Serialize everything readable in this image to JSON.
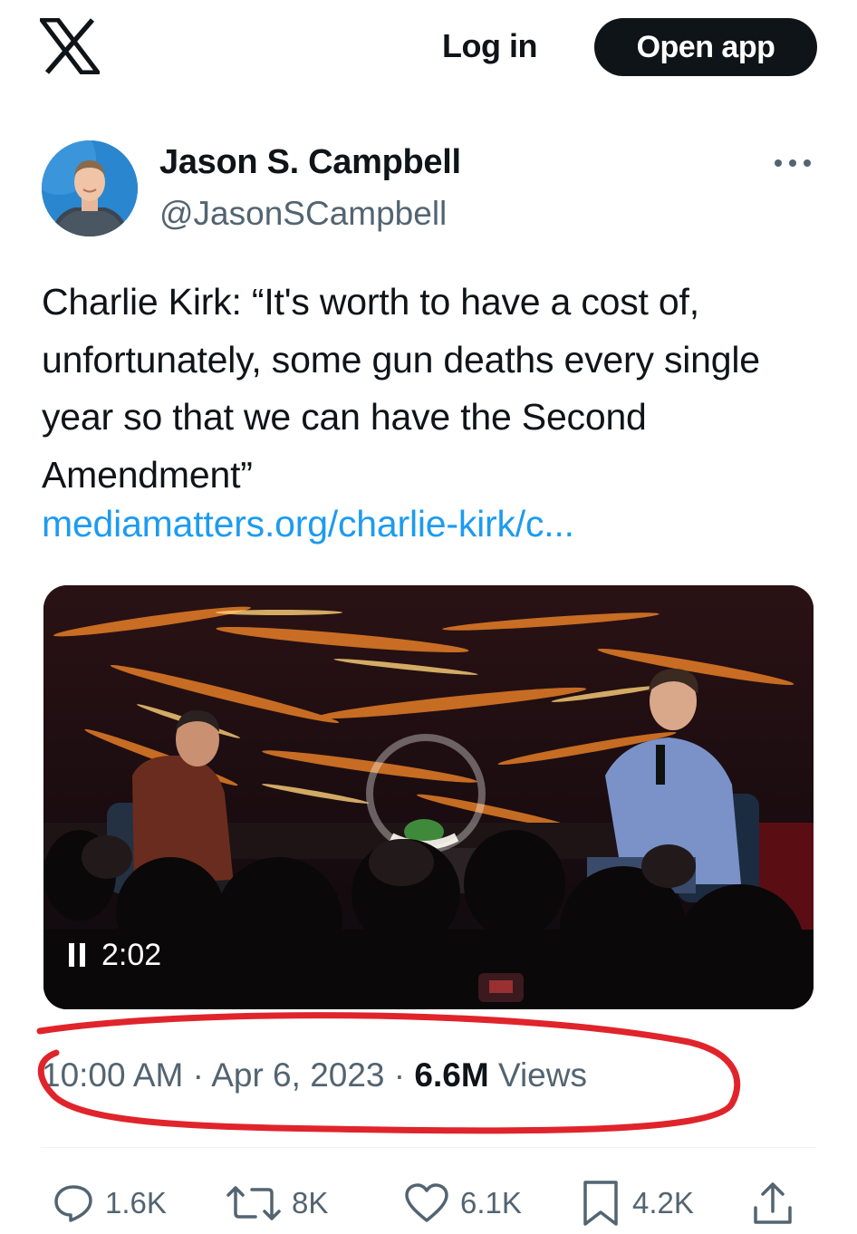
{
  "header": {
    "login_label": "Log in",
    "open_app_label": "Open app"
  },
  "author": {
    "name": "Jason S. Campbell",
    "handle": "@JasonSCampbell"
  },
  "tweet": {
    "text": "Charlie Kirk: “It's worth to have a cost of, unfortunately, some gun deaths every single year so that we can have the Second Amendment”",
    "link": "mediamatters.org/charlie-kirk/c..."
  },
  "video": {
    "duration": "2:02"
  },
  "meta": {
    "time": "10:00 AM",
    "separator": "·",
    "date": "Apr 6, 2023",
    "views_count": "6.6M",
    "views_label": "Views"
  },
  "actions": {
    "replies": "1.6K",
    "reposts": "8K",
    "likes": "6.1K",
    "bookmarks": "4.2K"
  },
  "colors": {
    "text": "#0f1419",
    "secondary": "#536471",
    "link": "#1d9bf0",
    "annotation": "#e0242b"
  }
}
